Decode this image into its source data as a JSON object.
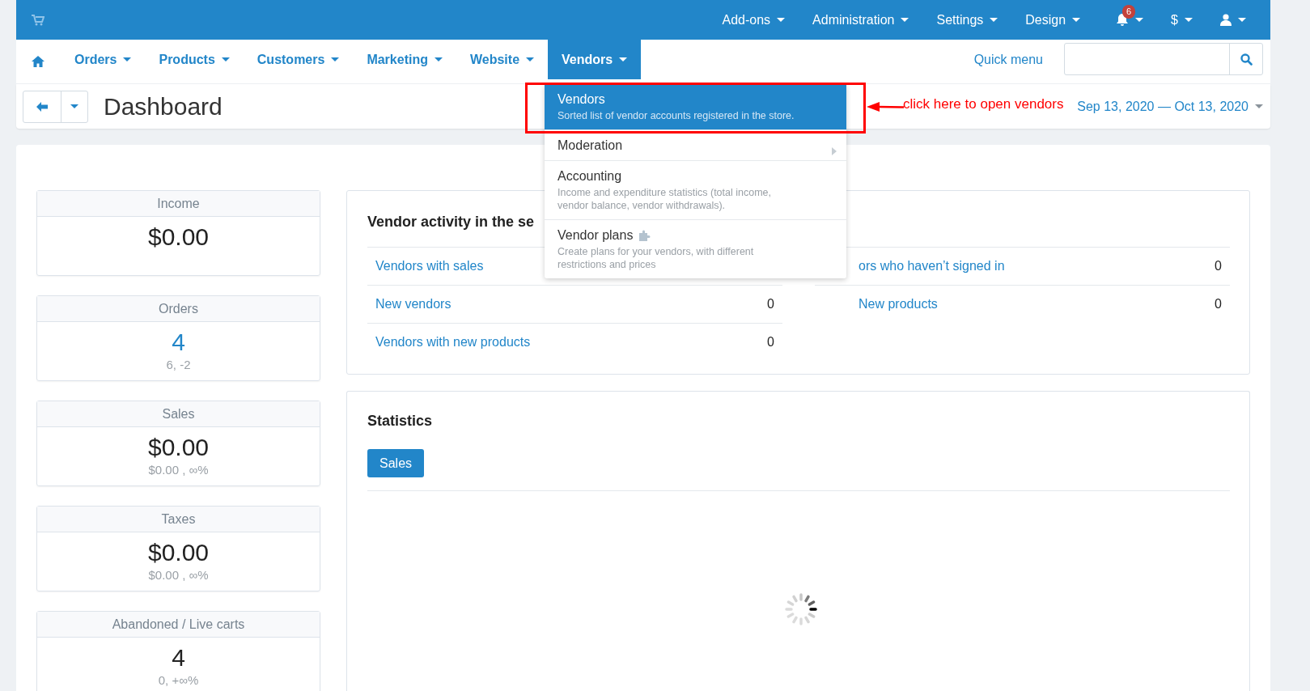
{
  "top_bar": {
    "items": [
      {
        "kind": "menu",
        "label": "Add-ons"
      },
      {
        "kind": "menu",
        "label": "Administration"
      },
      {
        "kind": "menu",
        "label": "Settings"
      },
      {
        "kind": "menu",
        "label": "Design"
      },
      {
        "kind": "notifications",
        "badge": "6"
      },
      {
        "kind": "menu",
        "label": "$"
      },
      {
        "kind": "user"
      }
    ]
  },
  "nav": {
    "tabs": [
      {
        "label": "Orders",
        "selected": false
      },
      {
        "label": "Products",
        "selected": false
      },
      {
        "label": "Customers",
        "selected": false
      },
      {
        "label": "Marketing",
        "selected": false
      },
      {
        "label": "Website",
        "selected": false
      },
      {
        "label": "Vendors",
        "selected": true
      }
    ],
    "quick_menu": "Quick menu"
  },
  "page_header": {
    "title": "Dashboard",
    "date_range": "Sep 13, 2020 — Oct 13, 2020"
  },
  "vendors_menu": {
    "items": [
      {
        "title": "Vendors",
        "description": "Sorted list of vendor accounts registered in the store.",
        "selected": true,
        "submenu": false,
        "addon": false
      },
      {
        "title": "Moderation",
        "selected": false,
        "submenu": true,
        "addon": false
      },
      {
        "title": "Accounting",
        "description": "Income and expenditure statistics (total income, vendor balance, vendor withdrawals).",
        "selected": false,
        "submenu": false,
        "addon": false
      },
      {
        "title": "Vendor plans",
        "description": "Create plans for your vendors, with different restrictions and prices",
        "selected": false,
        "submenu": false,
        "addon": true
      }
    ]
  },
  "annotation": {
    "text": "click here to open vendors"
  },
  "stat_cards": [
    {
      "title": "Income",
      "value": "$0.00",
      "link": false
    },
    {
      "title": "Orders",
      "value": "4",
      "link": true,
      "detail": "6, -2"
    },
    {
      "title": "Sales",
      "value": "$0.00",
      "link": false,
      "detail": "$0.00 , ∞%"
    },
    {
      "title": "Taxes",
      "value": "$0.00",
      "link": false,
      "detail": "$0.00 , ∞%"
    },
    {
      "title": "Abandoned / Live carts",
      "value": "4",
      "link": false,
      "detail": "0, +∞%"
    }
  ],
  "vendor_activity": {
    "title": "Vendor activity in the se",
    "columns": [
      [
        {
          "label": "Vendors with sales"
        },
        {
          "label": "New vendors",
          "value": "0"
        },
        {
          "label": "Vendors with new products",
          "value": "0"
        }
      ],
      [
        {
          "label": "ors who haven’t signed in",
          "value": "0"
        },
        {
          "label": "New products",
          "value": "0"
        }
      ]
    ]
  },
  "statistics": {
    "title": "Statistics",
    "tabs": [
      {
        "label": "Sales",
        "selected": true
      }
    ]
  }
}
